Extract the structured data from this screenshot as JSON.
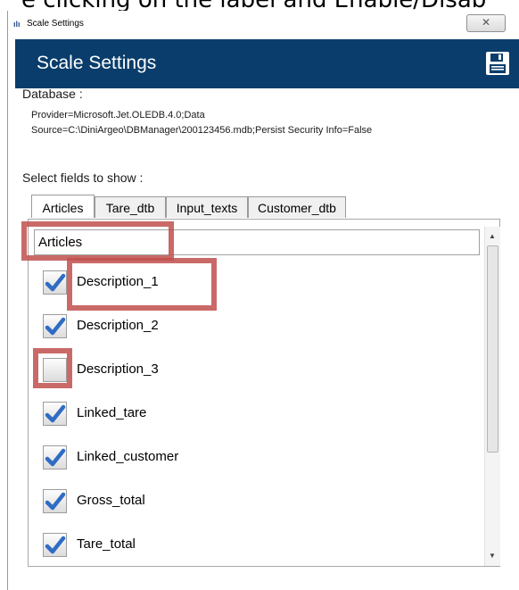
{
  "caption": "e clicking on the label and Enable/Disab",
  "window": {
    "title": "Scale Settings",
    "close_glyph": "✕"
  },
  "header": {
    "title": "Scale Settings",
    "save_icon": "floppy-disk-icon",
    "color": "#0a3d6b"
  },
  "database": {
    "label": "Database :",
    "connection_line1": "Provider=Microsoft.Jet.OLEDB.4.0;Data",
    "connection_line2": "Source=C:\\DiniArgeo\\DBManager\\200123456.mdb;Persist Security Info=False"
  },
  "fields": {
    "label": "Select fields to show :",
    "tabs": [
      {
        "label": "Articles",
        "active": true
      },
      {
        "label": "Tare_dtb",
        "active": false
      },
      {
        "label": "Input_texts",
        "active": false
      },
      {
        "label": "Customer_dtb",
        "active": false
      }
    ],
    "table_name_value": "Articles",
    "items": [
      {
        "label": "Description_1",
        "checked": true
      },
      {
        "label": "Description_2",
        "checked": true
      },
      {
        "label": "Description_3",
        "checked": false
      },
      {
        "label": "Linked_tare",
        "checked": true
      },
      {
        "label": "Linked_customer",
        "checked": true
      },
      {
        "label": "Gross_total",
        "checked": true
      },
      {
        "label": "Tare_total",
        "checked": true
      }
    ]
  },
  "annotation_color": "#c0504d"
}
